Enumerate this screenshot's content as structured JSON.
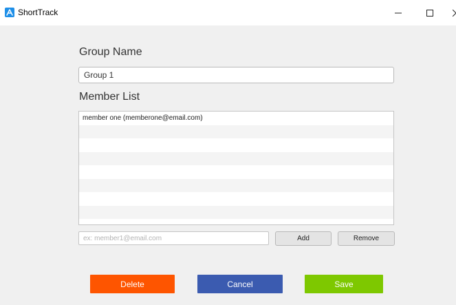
{
  "window": {
    "title": "ShortTrack",
    "icon": "app-logo-icon",
    "controls": [
      "minimize-icon",
      "maximize-icon",
      "close-icon"
    ]
  },
  "form": {
    "group_name_label": "Group Name",
    "group_name_value": "Group 1",
    "member_list_label": "Member List",
    "members": [
      "member one (memberone@email.com)"
    ],
    "email_placeholder": "ex: member1@email.com",
    "email_value": "",
    "add_label": "Add",
    "remove_label": "Remove"
  },
  "actions": {
    "delete_label": "Delete",
    "cancel_label": "Cancel",
    "save_label": "Save"
  },
  "colors": {
    "delete": "#fe5500",
    "cancel": "#3b5bb0",
    "save": "#7ec800",
    "app_icon": "#1e8fe8"
  }
}
